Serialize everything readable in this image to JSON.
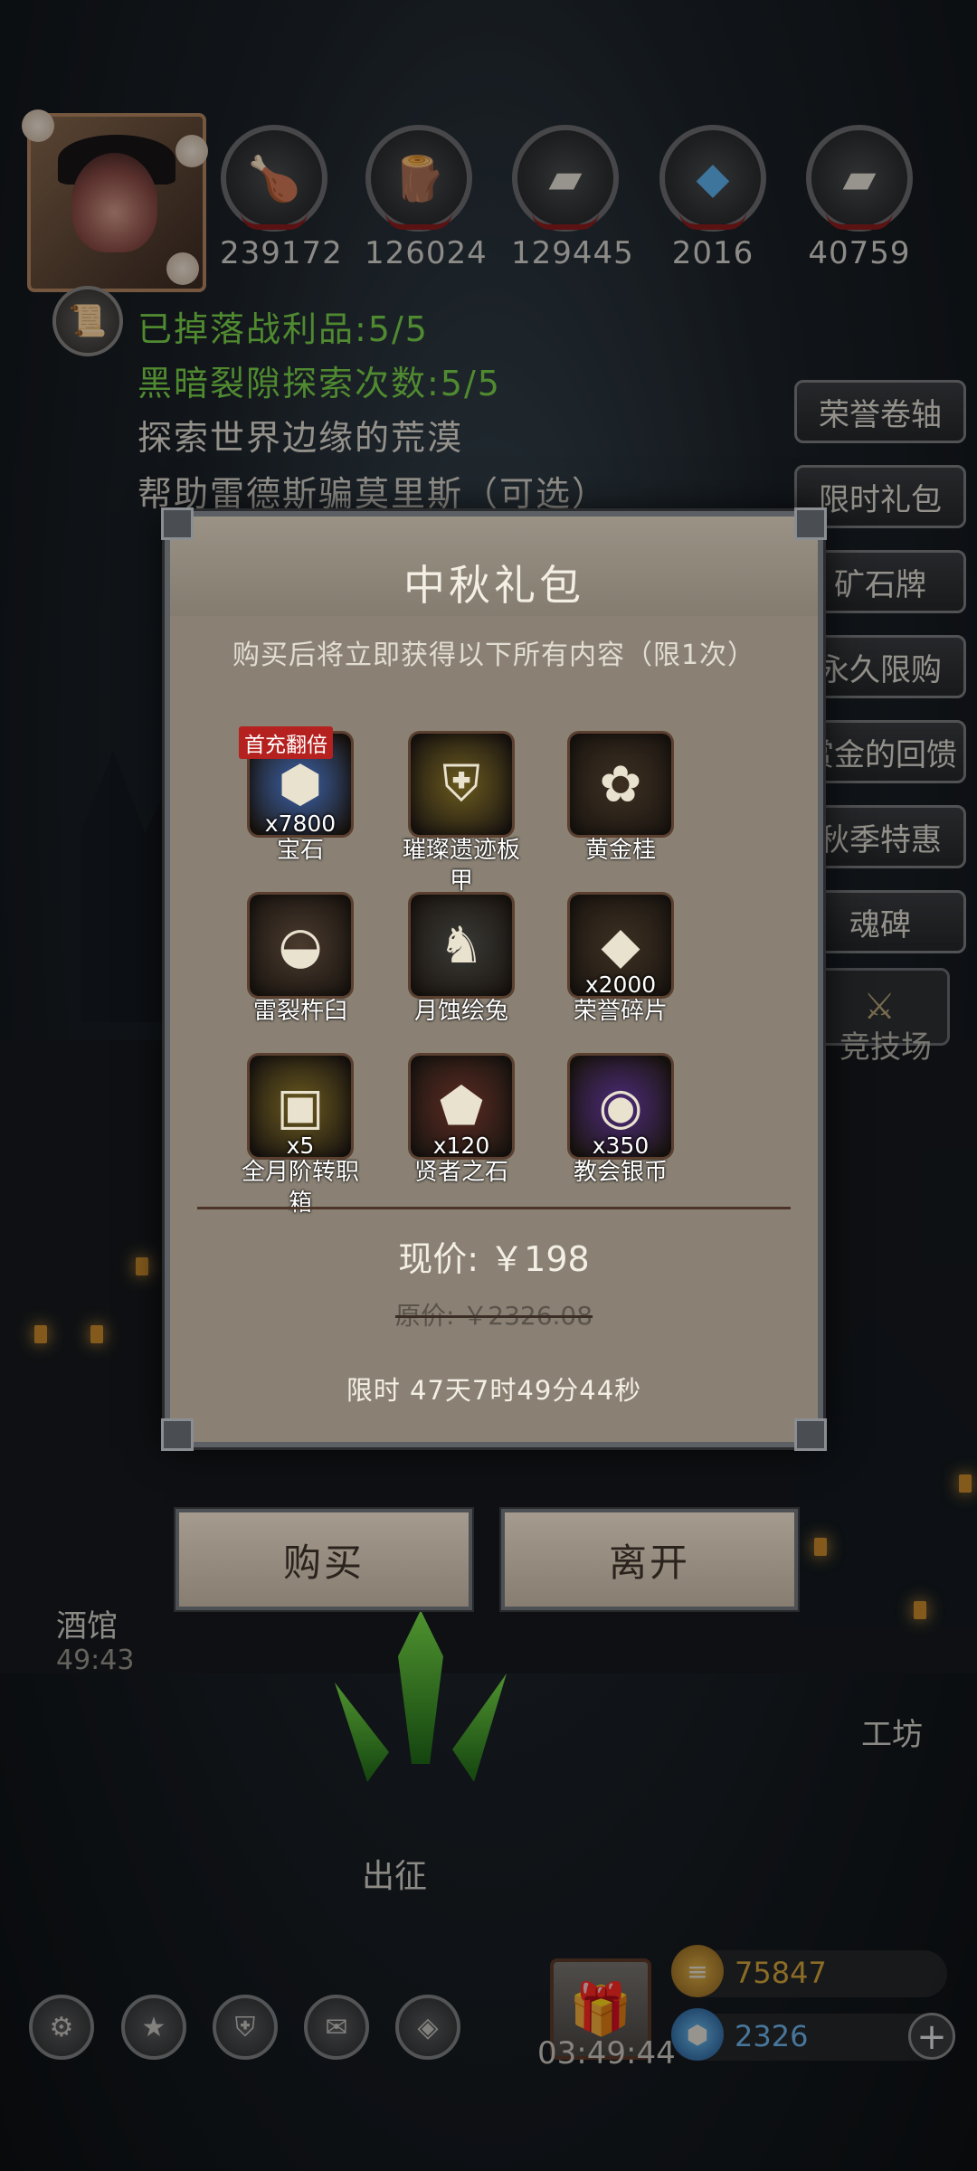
{
  "resources": [
    {
      "icon": "meat-icon",
      "value": "239172"
    },
    {
      "icon": "wood-icon",
      "value": "126024"
    },
    {
      "icon": "iron-icon",
      "value": "129445"
    },
    {
      "icon": "crystal-icon",
      "value": "2016"
    },
    {
      "icon": "steel-icon",
      "value": "40759"
    }
  ],
  "quests": [
    "已掉落战利品:5/5",
    "黑暗裂隙探索次数:5/5",
    "探索世界边缘的荒漠",
    "帮助雷德斯骗莫里斯（可选）"
  ],
  "side_menu": [
    "荣誉卷轴",
    "限时礼包",
    "矿石牌",
    "永久限购",
    "赏金的回馈",
    "秋季特惠",
    "魂碑"
  ],
  "arena_label": "竞技场",
  "modal": {
    "title": "中秋礼包",
    "subtitle": "购买后将立即获得以下所有内容（限1次）",
    "items": [
      {
        "name": "宝石",
        "qty": "x7800",
        "badge": "首充翻倍",
        "icon": "gem-icon",
        "color": "#3b62a8"
      },
      {
        "name": "璀璨遗迹板甲",
        "qty": "",
        "badge": "",
        "icon": "armor-icon",
        "color": "#6a5a1e"
      },
      {
        "name": "黄金桂",
        "qty": "",
        "badge": "",
        "icon": "flower-icon",
        "color": "#3d3022"
      },
      {
        "name": "雷裂杵臼",
        "qty": "",
        "badge": "",
        "icon": "mortar-icon",
        "color": "#4a3a2e"
      },
      {
        "name": "月蚀绘兔",
        "qty": "",
        "badge": "",
        "icon": "rabbit-icon",
        "color": "#3a3a36"
      },
      {
        "name": "荣誉碎片",
        "qty": "x2000",
        "badge": "",
        "icon": "fragment-icon",
        "color": "#3d3022"
      },
      {
        "name": "全月阶转职箱",
        "qty": "x5",
        "badge": "",
        "icon": "chest-icon",
        "color": "#6a5a1e"
      },
      {
        "name": "贤者之石",
        "qty": "x120",
        "badge": "",
        "icon": "stone-icon",
        "color": "#5a2a22"
      },
      {
        "name": "教会银币",
        "qty": "x350",
        "badge": "",
        "icon": "coin-icon",
        "color": "#4c2a7a"
      }
    ],
    "current_price": "现价: ￥198",
    "original_price": "原价: ￥2326.08",
    "time_limit": "限时 47天7时49分44秒"
  },
  "buttons": {
    "buy": "购买",
    "leave": "离开"
  },
  "locations": {
    "tavern": "酒馆",
    "tavern_timer": "49:43",
    "workshop": "工坊",
    "expedition": "出征"
  },
  "bottom_bar": {
    "icons": [
      "gear-icon",
      "star-icon",
      "shield-icon",
      "mail-icon",
      "cube-icon"
    ],
    "gift_timer": "03:49:44",
    "gold": "75847",
    "gems": "2326"
  }
}
